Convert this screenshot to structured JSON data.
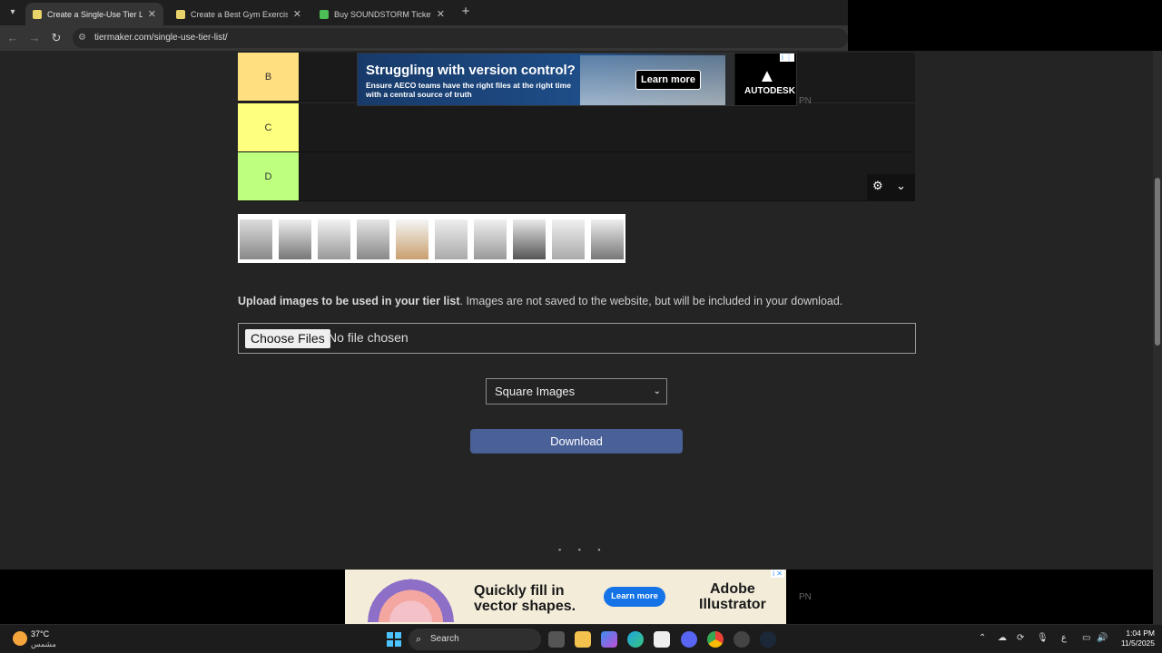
{
  "browser": {
    "tabs": [
      {
        "title": "Create a Single-Use Tier List (P",
        "active": true,
        "favicon_color": "#e8d36a"
      },
      {
        "title": "Create a Best Gym Exercises (10",
        "active": false,
        "favicon_color": "#e8d36a"
      },
      {
        "title": "Buy SOUNDSTORM Tickets 202",
        "active": false,
        "favicon_color": "#4bbf53"
      }
    ],
    "tab_close_glyph": "✕",
    "new_tab_glyph": "+",
    "url": "tiermaker.com/single-use-tier-list/"
  },
  "tiers": [
    {
      "label": "B",
      "color": "#ffdf80"
    },
    {
      "label": "C",
      "color": "#ffff7f"
    },
    {
      "label": "D",
      "color": "#bfff7f"
    }
  ],
  "top_ad": {
    "headline": "Struggling with version control?",
    "subtext": "Ensure AECO teams have the right files at the right time with a central source of truth",
    "cta": "Learn more",
    "brand": "AUTODESK",
    "logo_glyph": "▲"
  },
  "pn_label": "PN",
  "upload": {
    "bold_text": "Upload images to be used in your tier list",
    "rest_text": ". Images are not saved to the website, but will be included in your download.",
    "button_label": "Choose Files",
    "status": "No file chosen"
  },
  "image_shape_select": {
    "selected": "Square Images"
  },
  "download_label": "Download",
  "loading_dots": "▪ ▪ ▪",
  "bottom_ad": {
    "headline_line1": "Quickly fill in",
    "headline_line2": "vector shapes.",
    "cta": "Learn more",
    "brand_line1": "Adobe",
    "brand_line2": "Illustrator"
  },
  "taskbar": {
    "weather_temp": "37°C",
    "weather_desc": "مشمس",
    "search_label": "Search",
    "lang": "ع",
    "time": "1:04 PM",
    "date": "11/5/2025"
  }
}
